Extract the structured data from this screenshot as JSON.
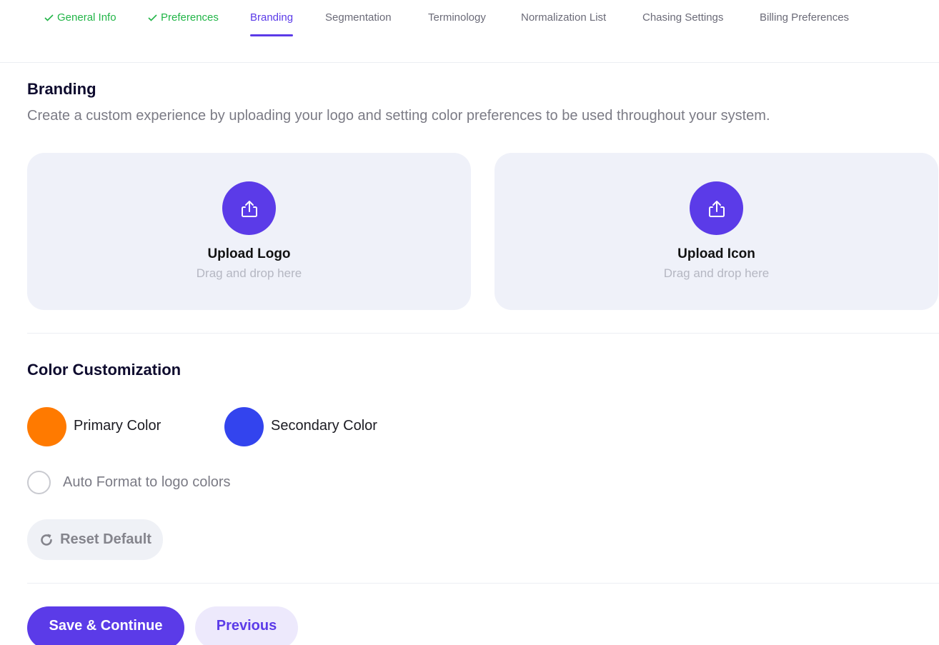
{
  "tabs": [
    {
      "label": "General Info",
      "state": "done"
    },
    {
      "label": "Preferences",
      "state": "done"
    },
    {
      "label": "Branding",
      "state": "active"
    },
    {
      "label": "Segmentation",
      "state": "default"
    },
    {
      "label": "Terminology",
      "state": "default"
    },
    {
      "label": "Normalization List",
      "state": "default"
    },
    {
      "label": "Chasing Settings",
      "state": "default"
    },
    {
      "label": "Billing Preferences",
      "state": "default"
    }
  ],
  "branding": {
    "title": "Branding",
    "description": "Create a custom experience by uploading your logo and setting color preferences to be used throughout your system.",
    "upload_logo": {
      "title": "Upload Logo",
      "subtitle": "Drag and drop here",
      "icon": "upload-icon"
    },
    "upload_icon": {
      "title": "Upload Icon",
      "subtitle": "Drag and drop here",
      "icon": "upload-icon"
    }
  },
  "colors": {
    "title": "Color Customization",
    "primary": {
      "label": "Primary Color",
      "value": "#ff7a00"
    },
    "secondary": {
      "label": "Secondary Color",
      "value": "#3344ee"
    },
    "auto_format": {
      "label": "Auto Format to logo colors",
      "checked": false
    },
    "reset_label": "Reset Default",
    "reset_icon": "refresh-icon"
  },
  "actions": {
    "save_label": "Save & Continue",
    "previous_label": "Previous"
  },
  "theme": {
    "accent": "#5b3be8",
    "done": "#22b548",
    "card_bg": "#eff1f9"
  }
}
